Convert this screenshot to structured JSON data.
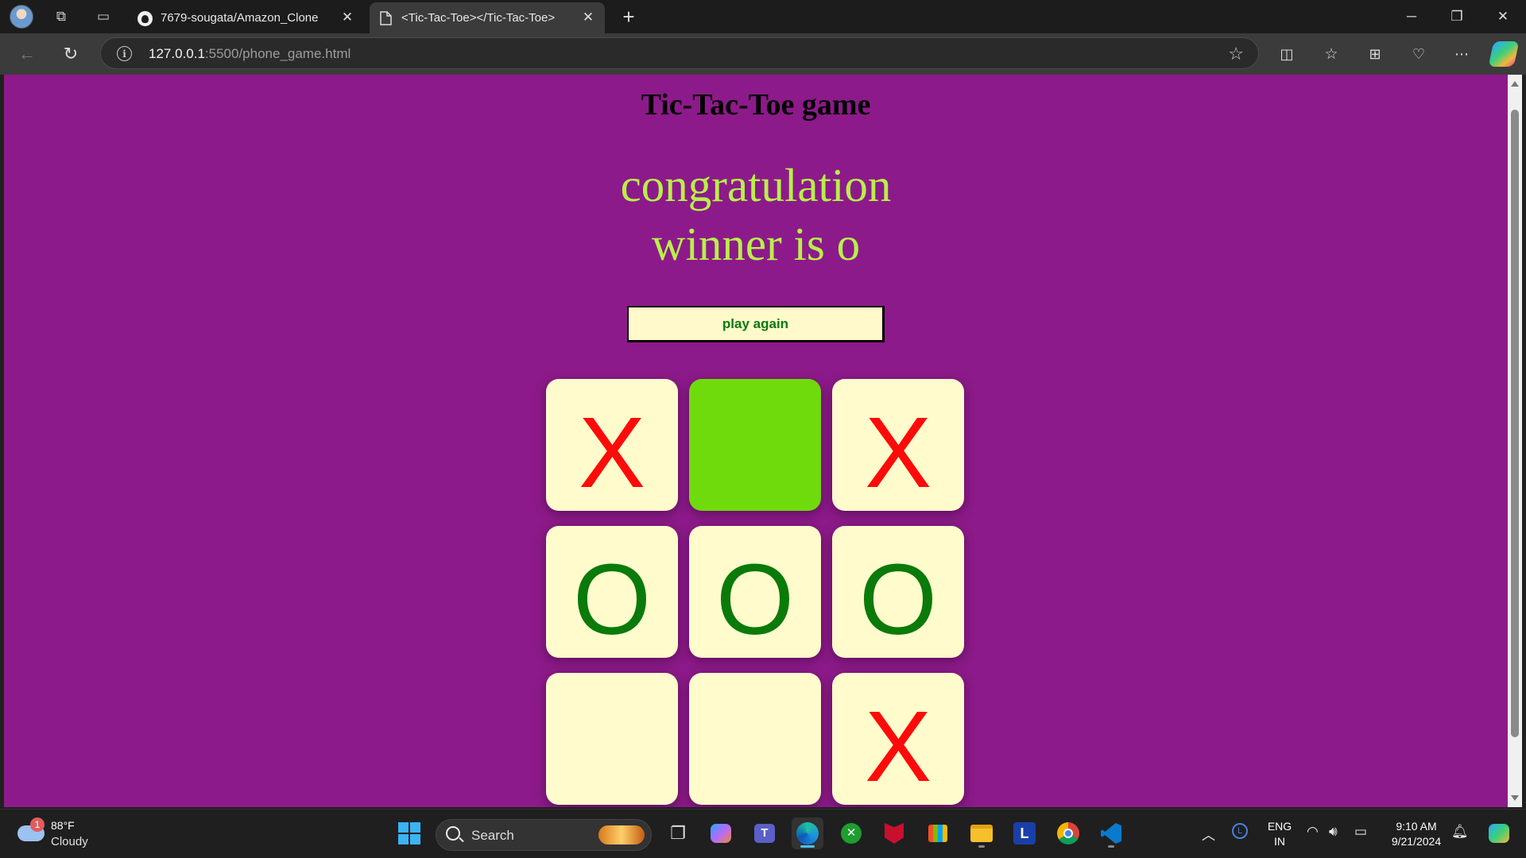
{
  "browser": {
    "tabs": [
      {
        "title": "7679-sougata/Amazon_Clone",
        "active": false,
        "icon": "github-icon"
      },
      {
        "title": "<Tic-Tac-Toe></Tic-Tac-Toe>",
        "active": true,
        "icon": "page-icon"
      }
    ],
    "address": {
      "host": "127.0.0.1",
      "rest": ":5500/phone_game.html"
    }
  },
  "page": {
    "title": "Tic-Tac-Toe game",
    "message_line1": "congratulation",
    "message_line2": "winner is o",
    "play_again_label": "play again",
    "board": [
      {
        "mark": "X",
        "highlighted": false
      },
      {
        "mark": "",
        "highlighted": true
      },
      {
        "mark": "X",
        "highlighted": false
      },
      {
        "mark": "O",
        "highlighted": false
      },
      {
        "mark": "O",
        "highlighted": false
      },
      {
        "mark": "O",
        "highlighted": false
      },
      {
        "mark": "",
        "highlighted": false
      },
      {
        "mark": "",
        "highlighted": false
      },
      {
        "mark": "X",
        "highlighted": false
      }
    ],
    "colors": {
      "background": "#8d1a8a",
      "message": "#b8f04a",
      "cell": "#fffbcc",
      "highlight": "#6fdb0c",
      "x": "#ff0a0a",
      "o": "#0a7a0a"
    }
  },
  "taskbar": {
    "weather_temp": "88°F",
    "weather_condition": "Cloudy",
    "weather_badge": "1",
    "search_placeholder": "Search",
    "language_line1": "ENG",
    "language_line2": "IN",
    "time": "9:10 AM",
    "date": "9/21/2024"
  }
}
